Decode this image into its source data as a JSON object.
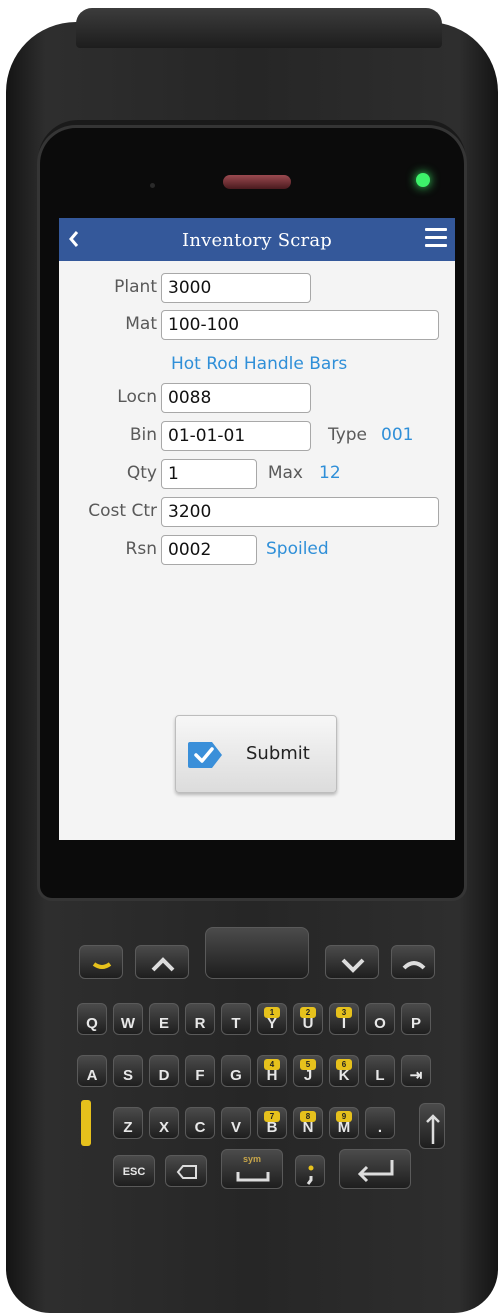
{
  "app": {
    "title": "Inventory Scrap"
  },
  "form": {
    "plant": {
      "label": "Plant",
      "value": "3000"
    },
    "mat": {
      "label": "Mat",
      "value": "100-100",
      "description": "Hot Rod Handle Bars"
    },
    "locn": {
      "label": "Locn",
      "value": "0088"
    },
    "bin": {
      "label": "Bin",
      "value": "01-01-01",
      "type_label": "Type",
      "type_value": "001"
    },
    "qty": {
      "label": "Qty",
      "value": "1",
      "max_label": "Max",
      "max_value": "12"
    },
    "cost_ctr": {
      "label": "Cost Ctr",
      "value": "3200"
    },
    "rsn": {
      "label": "Rsn",
      "value": "0002",
      "description": "Spoiled"
    }
  },
  "submit_label": "Submit",
  "colors": {
    "titlebar": "#34589a",
    "info_text": "#2f8fd8",
    "led": "#3df26a",
    "keypad_accent": "#e6c11c"
  },
  "icons": {
    "back": "chevron-left-icon",
    "menu": "hamburger-menu-icon",
    "submit": "checkmark-icon"
  },
  "keypad": {
    "row1": [
      "Q",
      "W",
      "E",
      "R",
      "T",
      "Y",
      "U",
      "I",
      "O",
      "P"
    ],
    "row2": [
      "A",
      "S",
      "D",
      "F",
      "G",
      "H",
      "J",
      "K",
      "L",
      "⇥"
    ],
    "row3": [
      "Z",
      "X",
      "C",
      "V",
      "B",
      "N",
      "M",
      "."
    ],
    "row1_sub": [
      "",
      "",
      "",
      "",
      "",
      "1",
      "2",
      "3",
      "",
      ""
    ],
    "row2_sub": [
      "",
      "",
      "",
      "",
      "",
      "4",
      "5",
      "6",
      "",
      ""
    ],
    "row3_sub": [
      "",
      "",
      "",
      "",
      "7",
      "8",
      "9",
      ""
    ],
    "esc": "ESC",
    "sym": "sym"
  }
}
